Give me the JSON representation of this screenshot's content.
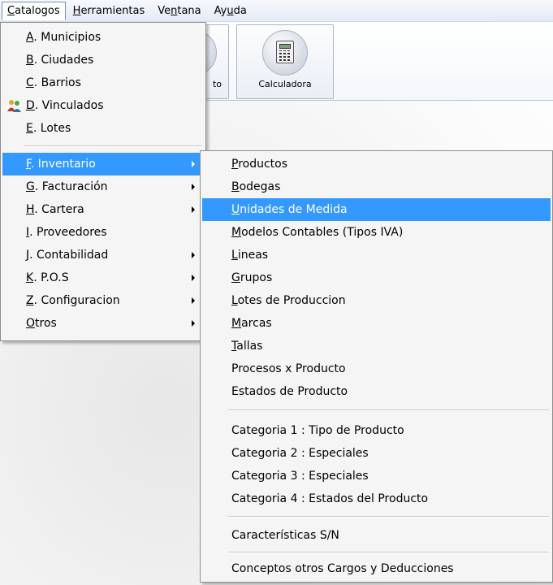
{
  "menubar": {
    "items": [
      {
        "mn": "C",
        "rest": "atalogos"
      },
      {
        "mn": "H",
        "rest": "erramientas"
      },
      {
        "pre": "Ve",
        "mn": "n",
        "rest": "tana"
      },
      {
        "pre": "Ay",
        "mn": "u",
        "rest": "da"
      }
    ]
  },
  "toolbar": {
    "partial_button_label": "to",
    "calculator_label": "Calculadora"
  },
  "catalogos_menu": {
    "items": [
      {
        "mn": "A",
        "rest": ". Municipios"
      },
      {
        "mn": "B",
        "rest": ". Ciudades"
      },
      {
        "mn": "C",
        "rest": ". Barrios"
      },
      {
        "mn": "D",
        "rest": ". Vinculados"
      },
      {
        "mn": "E",
        "rest": ". Lotes"
      },
      {
        "mn": "F",
        "rest": ".  Inventario"
      },
      {
        "mn": "G",
        "rest": ". Facturación"
      },
      {
        "mn": "H",
        "rest": ". Cartera"
      },
      {
        "mn": "I",
        "rest": ".  Proveedores"
      },
      {
        "mn": "J",
        "rest": ". Contabilidad"
      },
      {
        "mn": "K",
        "rest": ". P.O.S"
      },
      {
        "mn": "Z",
        "rest": ". Configuracion"
      },
      {
        "mn": "O",
        "rest": "tros"
      }
    ]
  },
  "inventario_menu": {
    "items": [
      {
        "mn": "P",
        "rest": "roductos"
      },
      {
        "mn": "B",
        "rest": "odegas"
      },
      {
        "mn": "U",
        "rest": "nidades de Medida"
      },
      {
        "mn": "M",
        "rest": "odelos Contables (Tipos IVA)"
      },
      {
        "mn": "L",
        "rest": "ineas"
      },
      {
        "mn": "G",
        "rest": "rupos"
      },
      {
        "mn": "L",
        "rest": "otes de Produccion"
      },
      {
        "mn": "M",
        "rest": "arcas"
      },
      {
        "mn": "T",
        "rest": "allas"
      },
      {
        "mn": "",
        "rest": "Procesos x Producto"
      },
      {
        "mn": "",
        "rest": "Estados de Producto"
      },
      {
        "mn": "",
        "rest": "Categoria 1 : Tipo de Producto"
      },
      {
        "mn": "",
        "rest": "Categoria 2 : Especiales"
      },
      {
        "mn": "",
        "rest": "Categoria 3 : Especiales"
      },
      {
        "mn": "",
        "rest": "Categoria 4 : Estados del Producto"
      },
      {
        "mn": "",
        "rest": "Características S/N"
      },
      {
        "mn": "",
        "rest": "Conceptos otros Cargos y Deducciones"
      }
    ]
  },
  "icons": {
    "vinculados": "people-icon",
    "calculator": "calculator-icon",
    "submenu": "chevron-right-icon"
  },
  "colors": {
    "highlight": "#3399ff",
    "menu_background": "#f5f5f5"
  }
}
